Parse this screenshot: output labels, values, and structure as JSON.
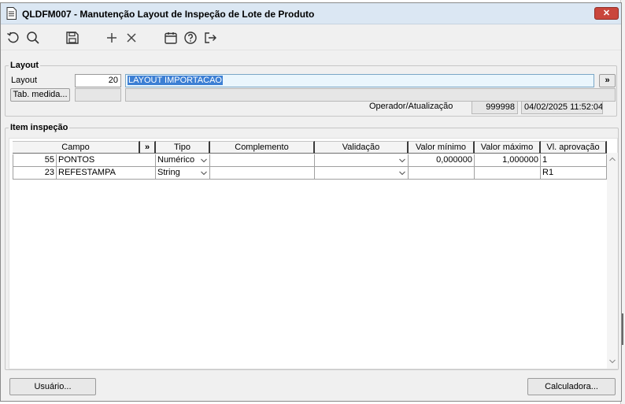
{
  "window": {
    "title": "QLDFM007 - Manutenção Layout de Inspeção de Lote de Produto",
    "close_label": "✕"
  },
  "toolbar": {
    "icons": [
      "undo-icon",
      "search-icon",
      "save-icon",
      "add-icon",
      "delete-icon",
      "calendar-icon",
      "help-icon",
      "exit-icon"
    ]
  },
  "layout_group": {
    "legend": "Layout",
    "layout_label": "Layout",
    "layout_code": "20",
    "layout_name": "LAYOUT IMPORTACAO",
    "more_button": "»",
    "tab_medida_button": "Tab. medida...",
    "tab_medida_value": "",
    "tab_medida_desc": "",
    "operador_label": "Operador/Atualização",
    "operador_value": "999998",
    "atualizacao_value": "04/02/2025 11:52:04"
  },
  "item_group": {
    "legend": "Item inspeção",
    "expand_button": "»",
    "columns": [
      "Campo",
      "Tipo",
      "Complemento",
      "Validação",
      "Valor mínimo",
      "Valor máximo",
      "Vl. aprovação"
    ],
    "rows": [
      {
        "campo_num": "55",
        "campo_nome": "PONTOS",
        "tipo": "Numérico",
        "complemento": "",
        "validacao": "",
        "valor_min": "0,000000",
        "valor_max": "1,000000",
        "aprovacao": "1"
      },
      {
        "campo_num": "23",
        "campo_nome": "REFESTAMPA",
        "tipo": "String",
        "complemento": "",
        "validacao": "",
        "valor_min": "",
        "valor_max": "",
        "aprovacao": "R1"
      }
    ]
  },
  "footer": {
    "usuario_button": "Usuário...",
    "calculadora_button": "Calculadora..."
  }
}
